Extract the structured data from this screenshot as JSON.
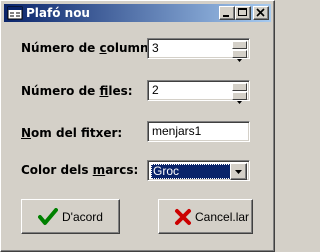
{
  "window": {
    "title": "Plafó nou",
    "icon": "app-window-icon"
  },
  "titlebar_buttons": {
    "minimize_icon": "minimize-icon",
    "maximize_icon": "maximize-icon",
    "close_icon": "close-icon"
  },
  "form": {
    "columns": {
      "label_pre": "Número de ",
      "label_accel": "c",
      "label_post": "olumnes:",
      "value": "3"
    },
    "rows": {
      "label_pre": "Número de ",
      "label_accel": "f",
      "label_post": "iles:",
      "value": "2"
    },
    "filename": {
      "label_accel": "N",
      "label_post": "om del fitxer:",
      "value": "menjars1"
    },
    "frame_color": {
      "label_pre": "Color dels ",
      "label_accel": "m",
      "label_post": "arcs:",
      "value": "Groc"
    }
  },
  "buttons": {
    "ok_label": "D'acord",
    "cancel_label": "Cancel.lar"
  },
  "colors": {
    "ok_check": "#008000",
    "cancel_x": "#cc0000",
    "title_bar": "#0a246a"
  }
}
